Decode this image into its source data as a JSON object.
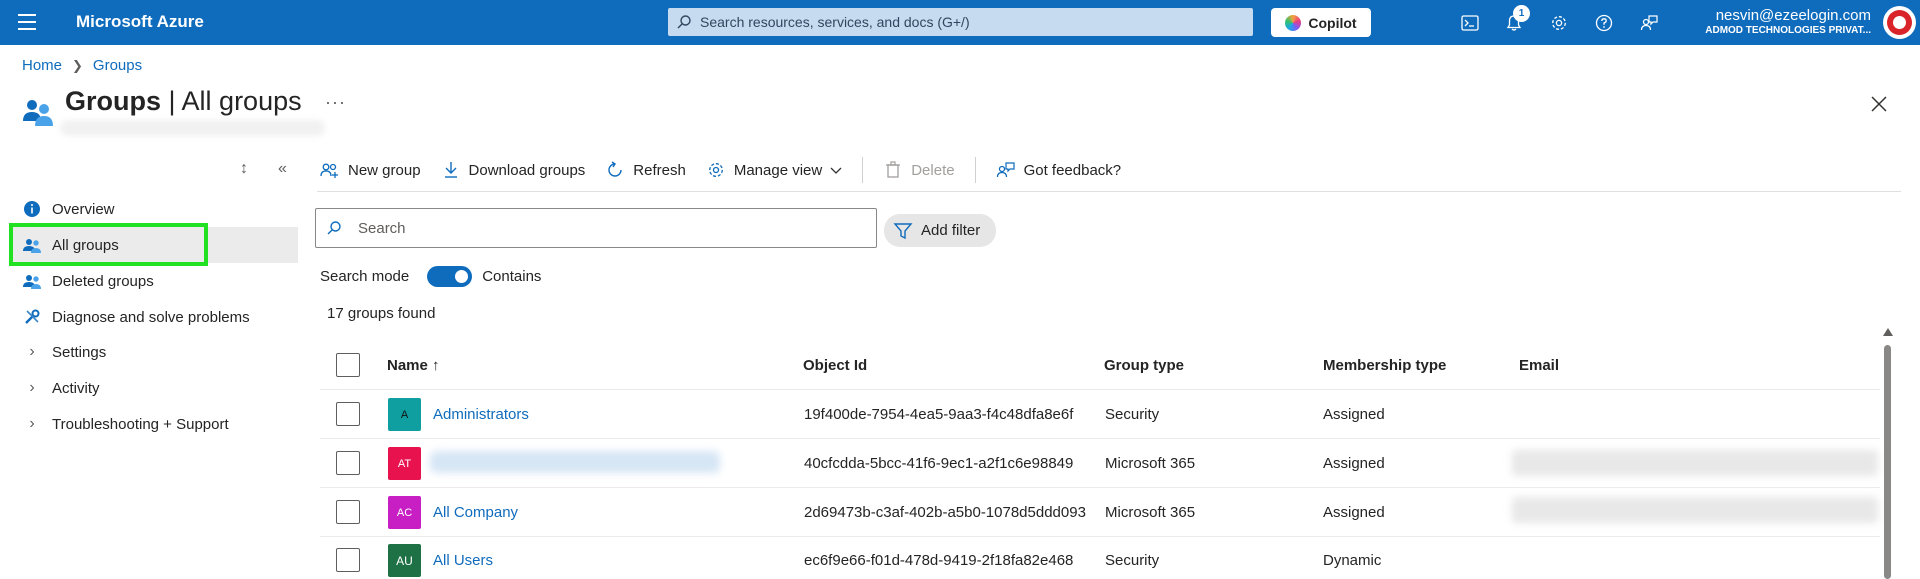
{
  "topbar": {
    "brand": "Microsoft Azure",
    "search_placeholder": "Search resources, services, and docs (G+/)",
    "copilot_label": "Copilot",
    "notification_count": "1",
    "user_email": "nesvin@ezeelogin.com",
    "user_org": "ADMOD TECHNOLOGIES PRIVAT..."
  },
  "breadcrumb": {
    "home": "Home",
    "groups": "Groups"
  },
  "header": {
    "title_bold": "Groups",
    "title_rest": " | All groups",
    "more": "···"
  },
  "sidebar": {
    "items": [
      {
        "label": "Overview"
      },
      {
        "label": "All groups"
      },
      {
        "label": "Deleted groups"
      },
      {
        "label": "Diagnose and solve problems"
      },
      {
        "label": "Settings"
      },
      {
        "label": "Activity"
      },
      {
        "label": "Troubleshooting + Support"
      }
    ]
  },
  "toolbar": {
    "new_group": "New group",
    "download_groups": "Download groups",
    "refresh": "Refresh",
    "manage_view": "Manage view",
    "delete": "Delete",
    "feedback": "Got feedback?"
  },
  "filters": {
    "search_placeholder": "Search",
    "add_filter": "Add filter",
    "search_mode_label": "Search mode",
    "search_mode_value": "Contains",
    "result_count": "17 groups found"
  },
  "table": {
    "columns": {
      "name": "Name ↑",
      "object_id": "Object Id",
      "group_type": "Group type",
      "membership_type": "Membership type",
      "email": "Email"
    },
    "rows": [
      {
        "initials": "A",
        "color": "#0f9fa0",
        "name": "Administrators",
        "object_id": "19f400de-7954-4ea5-9aa3-f4c48dfa8e6f",
        "group_type": "Security",
        "membership_type": "Assigned"
      },
      {
        "initials": "AT",
        "color": "#e8124f",
        "name": "",
        "object_id": "40cfcdda-5bcc-41f6-9ec1-a2f1c6e98849",
        "group_type": "Microsoft 365",
        "membership_type": "Assigned"
      },
      {
        "initials": "AC",
        "color": "#c81fc4",
        "name": "All Company",
        "object_id": "2d69473b-c3af-402b-a5b0-1078d5ddd093",
        "group_type": "Microsoft 365",
        "membership_type": "Assigned"
      },
      {
        "initials": "AU",
        "color": "#1e7145",
        "name": "All Users",
        "object_id": "ec6f9e66-f01d-478d-9419-2f18fa82e468",
        "group_type": "Security",
        "membership_type": "Dynamic"
      }
    ]
  }
}
